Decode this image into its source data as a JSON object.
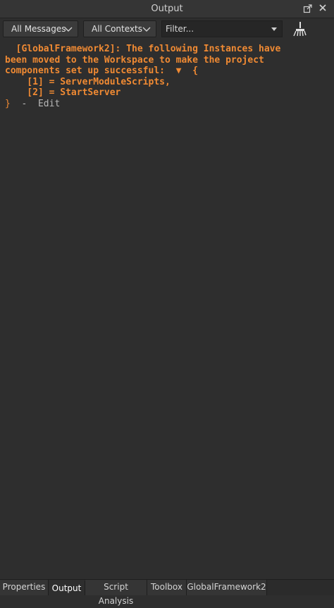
{
  "window": {
    "title": "Output"
  },
  "toolbar": {
    "messages_filter": "All Messages",
    "contexts_filter": "All Contexts",
    "filter_placeholder": "Filter..."
  },
  "output": {
    "lines": [
      "  [GlobalFramework2]: The following Instances have",
      "been moved to the Workspace to make the project",
      "components set up successful:  ▼  {",
      "    [1] = ServerModuleScripts,",
      "    [2] = StartServer"
    ],
    "closing_brace": "}",
    "separator": "  -  ",
    "edit_label": "Edit"
  },
  "tabs": [
    {
      "label": "Properties"
    },
    {
      "label": "Output"
    },
    {
      "label": "Script Analysis"
    },
    {
      "label": "Toolbox"
    },
    {
      "label": "GlobalFramework2"
    }
  ],
  "colors": {
    "warning_text": "#f08a33",
    "background": "#2e2e2e"
  }
}
